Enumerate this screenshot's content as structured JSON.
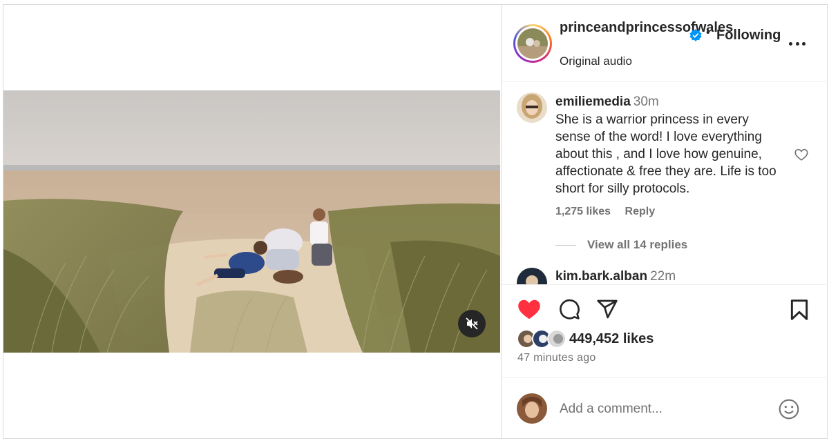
{
  "post": {
    "username": "princeandprincessofwales",
    "follow_status": "Following",
    "separator": "•",
    "audio_label": "Original audio",
    "verified": true
  },
  "comments": [
    {
      "username": "emiliemedia",
      "time": "30m",
      "text": "She is a warrior princess in every sense of the word! I love everything about this , and I love how genuine, affectionate & free they are. Life is too short for silly protocols.",
      "likes": "1,275 likes",
      "reply_label": "Reply",
      "view_replies": "View all 14 replies"
    },
    {
      "username": "kim.bark.alban",
      "time": "22m"
    }
  ],
  "engagement": {
    "likes": "449,452 likes",
    "posted": "47 minutes ago",
    "liked": true
  },
  "add_comment": {
    "placeholder": "Add a comment..."
  },
  "icons": {
    "like": "heart-icon",
    "comment": "comment-icon",
    "share": "share-icon",
    "save": "bookmark-icon",
    "mute": "muted-speaker-icon",
    "more": "more-options-icon",
    "emoji": "emoji-icon",
    "verified": "verified-badge-icon",
    "comment_like": "heart-outline-icon"
  },
  "colors": {
    "like_red": "#ff3040",
    "verified_blue": "#0095f6",
    "text_primary": "#262626",
    "text_secondary": "#737373"
  }
}
